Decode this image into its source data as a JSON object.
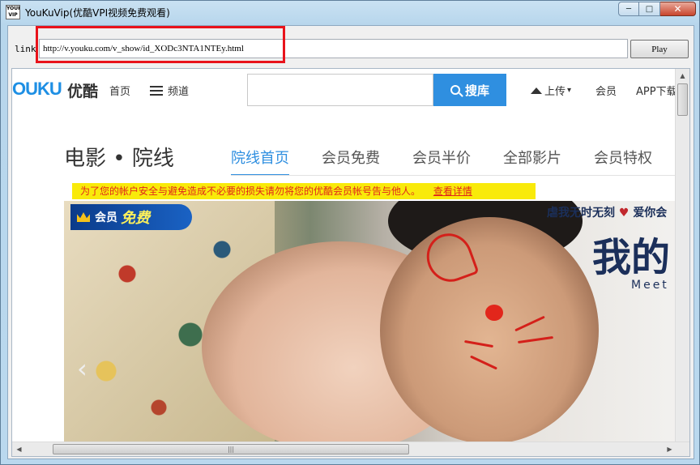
{
  "window": {
    "icon_text": "YOUKU VIP",
    "title": "YouKuVip(优酷VPI视频免费观看)",
    "min_glyph": "─",
    "max_glyph": "□",
    "close_glyph": "✕"
  },
  "toolbar": {
    "link_label": "link",
    "url_value": "http://v.youku.com/v_show/id_XODc3NTA1NTEy.html",
    "play_label": "Play"
  },
  "site": {
    "logo": "OUKU",
    "logo_cn": "优酷",
    "nav_home": "首页",
    "nav_channel": "频道",
    "search_placeholder": "",
    "search_button": "搜库",
    "upload": "上传",
    "upload_caret": "▾",
    "member": "会员",
    "app_download": "APP下载"
  },
  "section": {
    "title": "电影 • 院线",
    "tabs": [
      {
        "label": "院线首页"
      },
      {
        "label": "会员免费"
      },
      {
        "label": "会员半价"
      },
      {
        "label": "全部影片"
      },
      {
        "label": "会员特权"
      }
    ]
  },
  "notice": {
    "text": "为了您的帐户安全与避免造成不必要的损失请勿将您的优酷会员帐号告与他人。",
    "detail_link": "查看详情"
  },
  "banner": {
    "badge_text": "会员",
    "badge_free": "免费",
    "tagline_left": "虐我无时无刻",
    "tagline_heart": "♥",
    "tagline_right": "爱你会",
    "movie_title": "我的",
    "movie_sub": "Meet",
    "prev_glyph": "‹"
  },
  "scroll": {
    "up": "▲",
    "left": "◀",
    "right": "▶",
    "grip": "|||"
  }
}
